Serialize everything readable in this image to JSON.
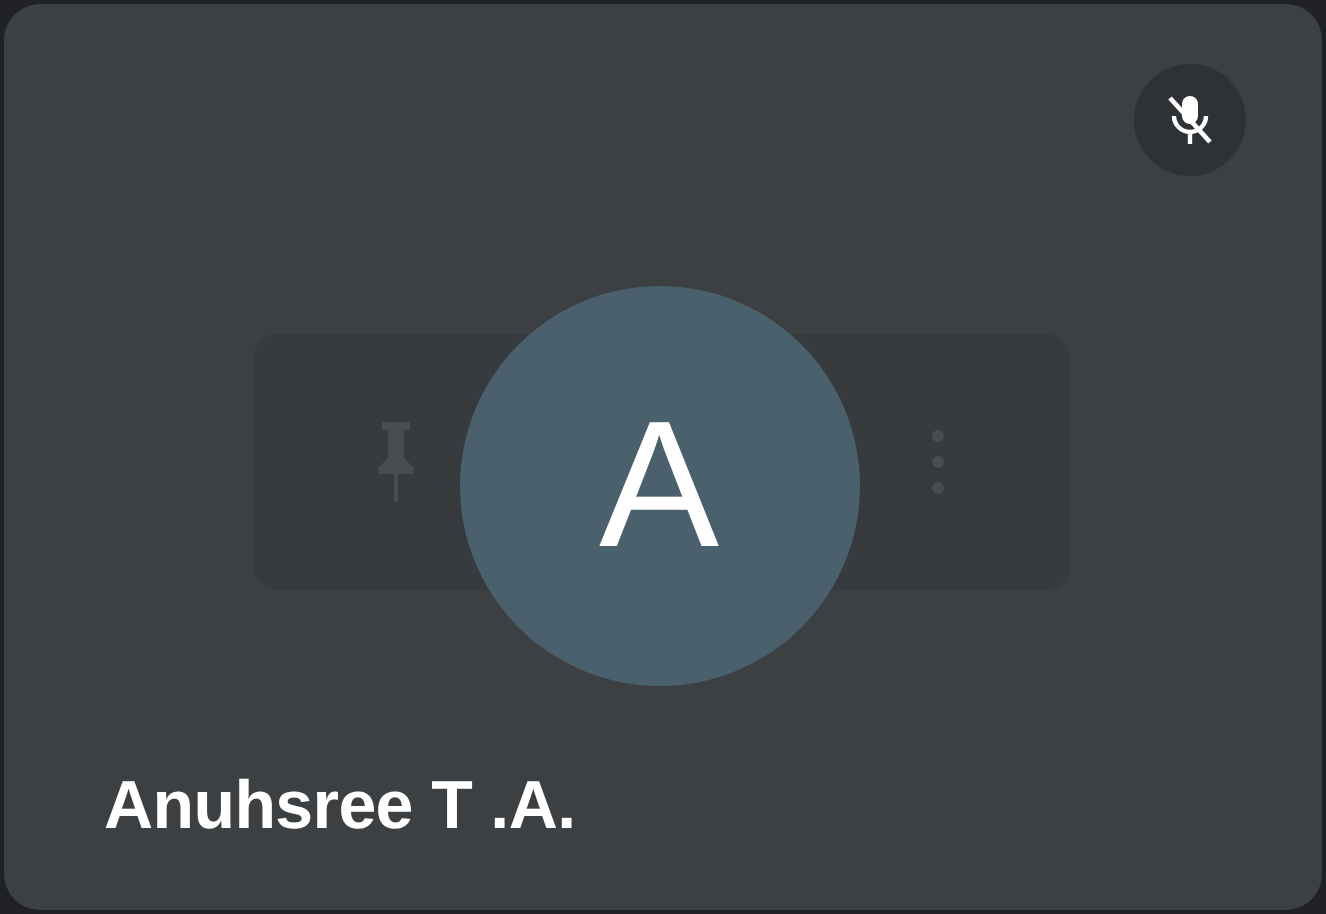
{
  "participant": {
    "initial": "A",
    "name": "Anuhsree T .A.",
    "muted": true
  }
}
